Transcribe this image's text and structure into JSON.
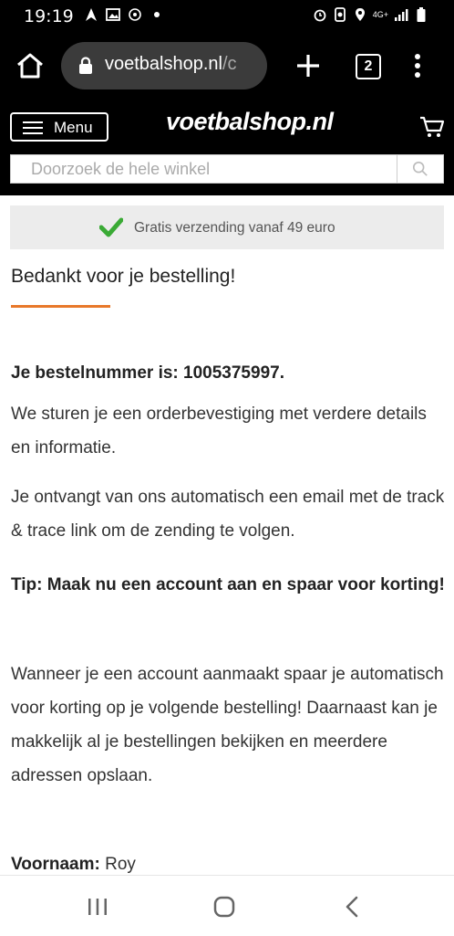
{
  "status_bar": {
    "time": "19:19",
    "network": "4G+"
  },
  "browser": {
    "url_main": "voetbalshop.nl",
    "url_rest": "/c",
    "tab_count": "2"
  },
  "site_header": {
    "menu_label": "Menu",
    "logo": "voetbalshop.nl",
    "search_placeholder": "Doorzoek de hele winkel"
  },
  "shipping_banner": {
    "text": "Gratis verzending vanaf 49 euro"
  },
  "content": {
    "title": "Bedankt voor je bestelling!",
    "order_label": "Je bestelnummer is: ",
    "order_number": "1005375997.",
    "p_confirmation": "We sturen je een orderbevestiging met verdere details en informatie.",
    "p_tracking": "Je ontvangt van ons automatisch een email met de track & trace link om de zending te volgen.",
    "tip": "Tip: Maak nu een account aan en spaar voor korting!",
    "p_account": "Wanneer je een account aanmaakt spaar je automatisch voor korting op je volgende bestelling! Daarnaast kan je makkelijk al je bestellingen bekijken en meerdere adressen opslaan.",
    "first_name_label": "Voornaam:",
    "first_name_value": " Roy"
  },
  "colors": {
    "accent": "#e8782a",
    "check": "#3aaa35"
  }
}
